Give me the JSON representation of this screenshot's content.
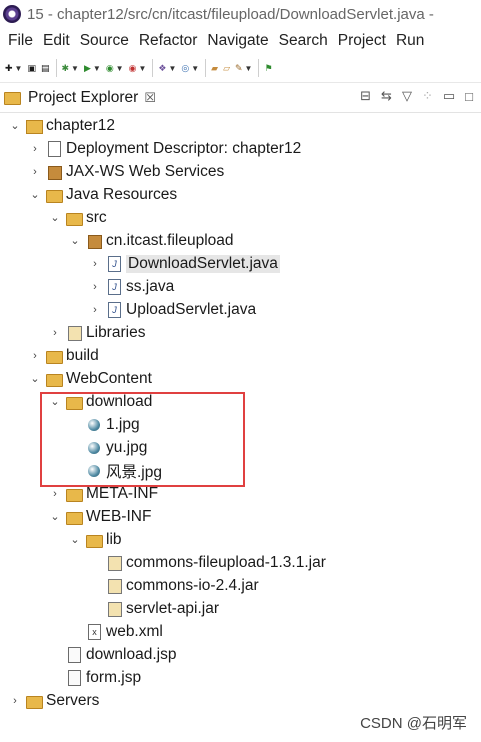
{
  "window": {
    "title": "15 - chapter12/src/cn/itcast/fileupload/DownloadServlet.java -"
  },
  "menu": [
    "File",
    "Edit",
    "Source",
    "Refactor",
    "Navigate",
    "Search",
    "Project",
    "Run"
  ],
  "view": {
    "title": "Project Explorer",
    "close": "☒"
  },
  "tree": [
    {
      "label": "chapter12",
      "type": "project",
      "expand": "open"
    },
    {
      "label": "Deployment Descriptor: chapter12",
      "type": "descriptor",
      "expand": "closed"
    },
    {
      "label": "JAX-WS Web Services",
      "type": "webservice",
      "expand": "closed"
    },
    {
      "label": "Java Resources",
      "type": "resources",
      "expand": "open"
    },
    {
      "label": "src",
      "type": "srcfolder",
      "expand": "open"
    },
    {
      "label": "cn.itcast.fileupload",
      "type": "package",
      "expand": "open"
    },
    {
      "label": "DownloadServlet.java",
      "type": "java",
      "expand": "closed",
      "selected": true
    },
    {
      "label": "ss.java",
      "type": "java",
      "expand": "closed"
    },
    {
      "label": "UploadServlet.java",
      "type": "java",
      "expand": "closed"
    },
    {
      "label": "Libraries",
      "type": "libraries",
      "expand": "closed"
    },
    {
      "label": "build",
      "type": "folder",
      "expand": "closed"
    },
    {
      "label": "WebContent",
      "type": "folder",
      "expand": "open"
    },
    {
      "label": "download",
      "type": "folder",
      "expand": "open"
    },
    {
      "label": "1.jpg",
      "type": "image",
      "expand": "none"
    },
    {
      "label": "yu.jpg",
      "type": "image",
      "expand": "none"
    },
    {
      "label": "风景.jpg",
      "type": "image",
      "expand": "none"
    },
    {
      "label": "META-INF",
      "type": "folder",
      "expand": "closed"
    },
    {
      "label": "WEB-INF",
      "type": "folder",
      "expand": "open"
    },
    {
      "label": "lib",
      "type": "folder",
      "expand": "open"
    },
    {
      "label": "commons-fileupload-1.3.1.jar",
      "type": "jar",
      "expand": "none"
    },
    {
      "label": "commons-io-2.4.jar",
      "type": "jar",
      "expand": "none"
    },
    {
      "label": "servlet-api.jar",
      "type": "jar",
      "expand": "none"
    },
    {
      "label": "web.xml",
      "type": "xml",
      "expand": "none"
    },
    {
      "label": "download.jsp",
      "type": "jsp",
      "expand": "none"
    },
    {
      "label": "form.jsp",
      "type": "jsp",
      "expand": "none"
    },
    {
      "label": "Servers",
      "type": "folder",
      "expand": "closed"
    }
  ],
  "watermark": "CSDN @石明军",
  "colors": {
    "highlight_box": "#e04040",
    "selection": "#e6e6e6"
  }
}
